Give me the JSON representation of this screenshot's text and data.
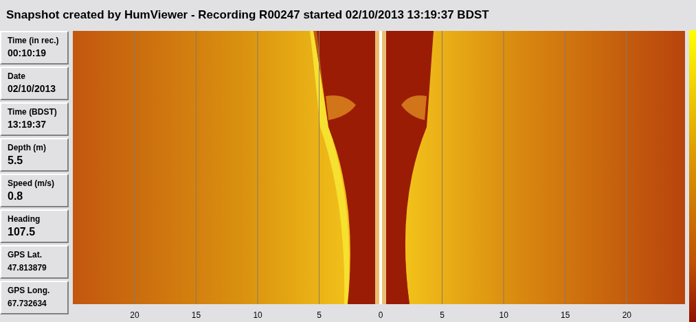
{
  "window": {
    "title": "Snapshot created by HumViewer - Recording R00247 started 02/10/2013 13:19:37 BDST"
  },
  "readouts": [
    {
      "label": "Time (in rec.)",
      "value": "00:10:19",
      "kind": "normal"
    },
    {
      "label": "Date",
      "value": "02/10/2013",
      "kind": "normal"
    },
    {
      "label": "Time (BDST)",
      "value": "13:19:37",
      "kind": "normal"
    },
    {
      "label": "Depth (m)",
      "value": "5.5",
      "kind": "large"
    },
    {
      "label": "Speed (m/s)",
      "value": "0.8",
      "kind": "large"
    },
    {
      "label": "Heading",
      "value": "107.5",
      "kind": "large"
    },
    {
      "label": "GPS Lat.",
      "value": "47.813879",
      "kind": "small"
    },
    {
      "label": "GPS Long.",
      "value": "67.732634",
      "kind": "small"
    }
  ],
  "sonar": {
    "kind": "picture",
    "axis_labels": [
      "20",
      "15",
      "10",
      "5",
      "0",
      "5",
      "10",
      "15",
      "20"
    ]
  }
}
